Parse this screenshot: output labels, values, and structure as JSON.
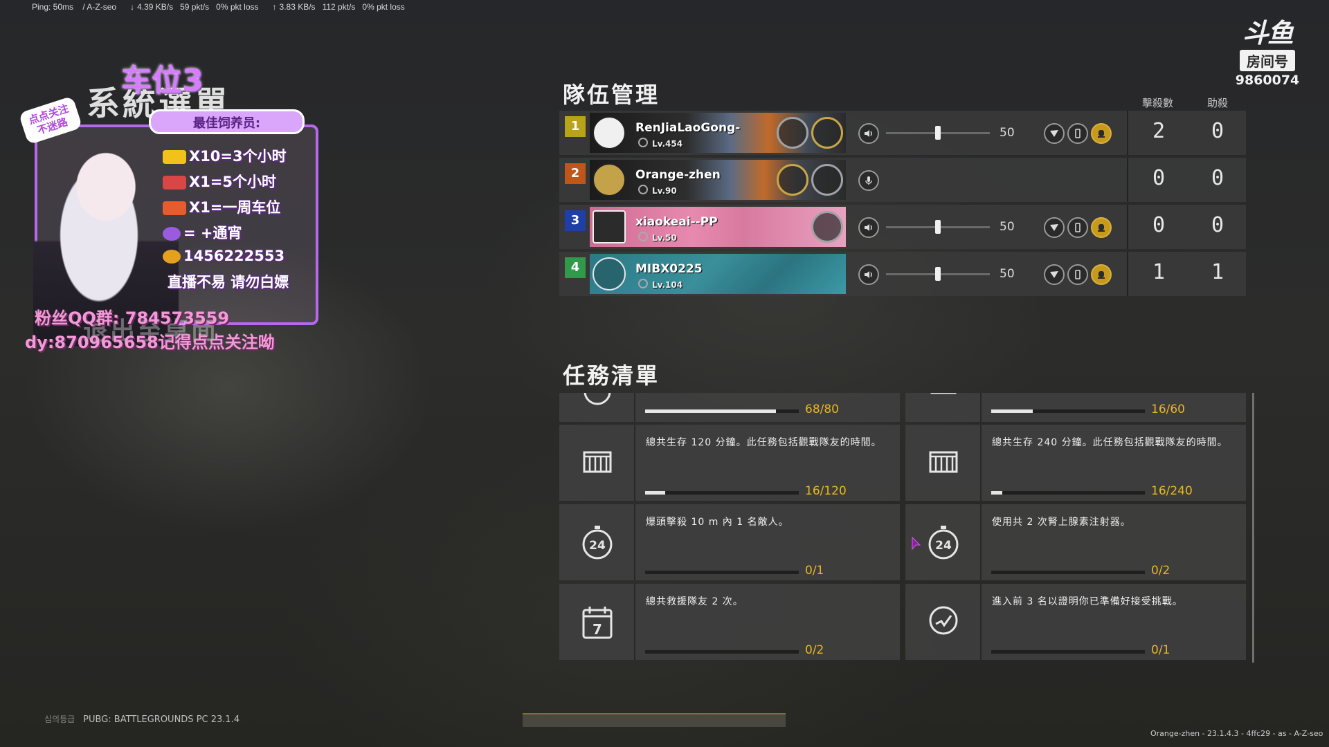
{
  "netstats": {
    "ping": "Ping: 50ms",
    "server": "/ A-Z-seo",
    "down_rate": "4.39 KB/s",
    "down_pkts": "59 pkt/s",
    "down_loss": "0% pkt loss",
    "up_rate": "3.83 KB/s",
    "up_pkts": "112 pkt/s",
    "up_loss": "0% pkt loss"
  },
  "overlay": {
    "slot_label": "车位3",
    "menu_title": "系統選單",
    "follow_text": "点点关注 不迷路",
    "banner": "最佳饲养员:",
    "rewards": [
      "X10=3个小时",
      "X1=5个小时",
      "X1=一周车位",
      "=  +通宵",
      "1456222553"
    ],
    "notice": "直播不易 请勿白嫖",
    "qq_group": "粉丝QQ群: 784573559",
    "douyin": "dy:870965658记得点点关注呦",
    "ghost_text": "退出至桌面"
  },
  "logo": {
    "mark": "斗鱼",
    "room_label": "房间号",
    "room_number": "9860074"
  },
  "team": {
    "title": "隊伍管理",
    "kills_header": "擊殺數",
    "assists_header": "助殺",
    "members": [
      {
        "slot": "1",
        "name": "RenJiaLaoGong-",
        "level": "Lv.454",
        "volume": "50",
        "volume_pct": 50,
        "kills": "2",
        "assists": "0",
        "slot_color": "#b9a319",
        "is_self": false
      },
      {
        "slot": "2",
        "name": "Orange-zhen",
        "level": "Lv.90",
        "volume": "",
        "volume_pct": null,
        "kills": "0",
        "assists": "0",
        "slot_color": "#c0561a",
        "is_self": true
      },
      {
        "slot": "3",
        "name": "xiaokeai--PP",
        "level": "Lv.50",
        "volume": "50",
        "volume_pct": 50,
        "kills": "0",
        "assists": "0",
        "slot_color": "#1f3fa8",
        "is_self": false
      },
      {
        "slot": "4",
        "name": "MIBX0225",
        "level": "Lv.104",
        "volume": "50",
        "volume_pct": 50,
        "kills": "1",
        "assists": "1",
        "slot_color": "#2e9a4a",
        "is_self": false
      }
    ],
    "icons": [
      "speaker-icon",
      "microphone-icon",
      "map-marker-icon",
      "phone-icon",
      "report-icon"
    ]
  },
  "missions": {
    "title": "任務清單",
    "items": [
      {
        "desc": "",
        "progress": "68/80",
        "ratio": 0.85,
        "icon": "stopwatch-icon"
      },
      {
        "desc": "",
        "progress": "16/60",
        "ratio": 0.27,
        "icon": "crate-icon"
      },
      {
        "desc": "總共生存 120 分鐘。此任務包括觀戰隊友的時間。",
        "progress": "16/120",
        "ratio": 0.13,
        "icon": "crate-icon"
      },
      {
        "desc": "總共生存 240 分鐘。此任務包括觀戰隊友的時間。",
        "progress": "16/240",
        "ratio": 0.07,
        "icon": "crate-icon"
      },
      {
        "desc": "爆頭擊殺 10 m 內 1 名敵人。",
        "progress": "0/1",
        "ratio": 0,
        "icon": "stopwatch-24-icon"
      },
      {
        "desc": "使用共 2 次腎上腺素注射器。",
        "progress": "0/2",
        "ratio": 0,
        "icon": "stopwatch-24-icon"
      },
      {
        "desc": "總共救援隊友 2 次。",
        "progress": "0/2",
        "ratio": 0,
        "icon": "calendar-7-icon"
      },
      {
        "desc": "進入前 3 名以證明你已準備好接受挑戰。",
        "progress": "0/1",
        "ratio": 0,
        "icon": "challenge-icon"
      }
    ]
  },
  "footer": {
    "rating": "심의등급",
    "game_version": "PUBG: BATTLEGROUNDS PC  23.1.4",
    "build_info": "Orange-zhen - 23.1.4.3 - 4ffc29 - as - A-Z-seo"
  }
}
